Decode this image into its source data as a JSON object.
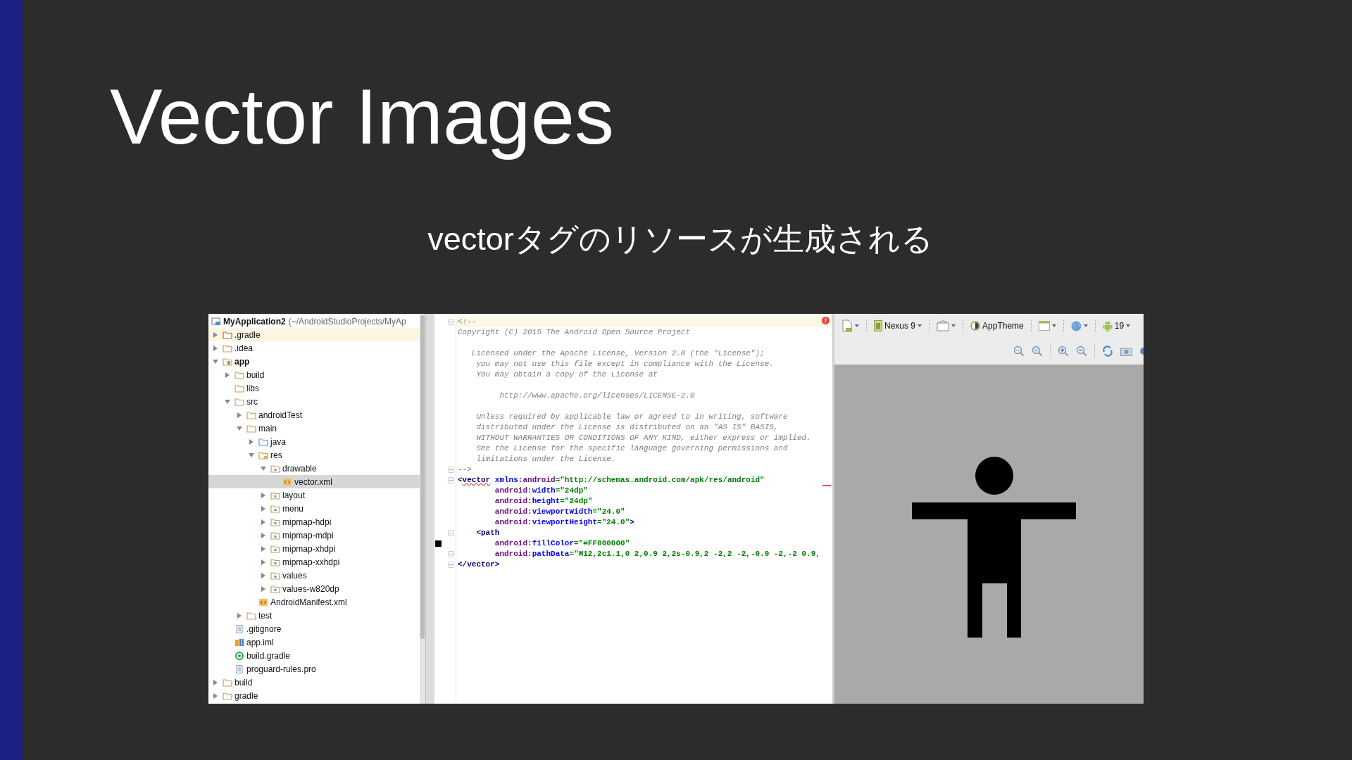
{
  "slide": {
    "title": "Vector Images",
    "subtitle": "vectorタグのリソースが生成される"
  },
  "project_tree": {
    "root": {
      "name": "MyApplication2",
      "path": "(~/AndroidStudioProjects/MyAp"
    },
    "items": [
      {
        "label": ".gradle",
        "kind": "folder-red",
        "expanded": false,
        "selected": false,
        "highlighted": true
      },
      {
        "label": ".idea",
        "kind": "folder",
        "expanded": false,
        "selected": false,
        "highlighted": false
      },
      {
        "label": "app",
        "kind": "module",
        "expanded": true,
        "selected": false,
        "highlighted": false,
        "bold": true,
        "children": [
          {
            "label": "build",
            "kind": "folder",
            "expanded": false,
            "selected": false,
            "highlighted": false
          },
          {
            "label": "libs",
            "kind": "folder",
            "selected": false,
            "highlighted": false
          },
          {
            "label": "src",
            "kind": "folder",
            "expanded": true,
            "selected": false,
            "highlighted": false,
            "children": [
              {
                "label": "androidTest",
                "kind": "folder",
                "expanded": false,
                "selected": false,
                "highlighted": false
              },
              {
                "label": "main",
                "kind": "folder",
                "expanded": true,
                "selected": false,
                "highlighted": false,
                "children": [
                  {
                    "label": "java",
                    "kind": "folder-blue",
                    "expanded": false,
                    "selected": false,
                    "highlighted": false
                  },
                  {
                    "label": "res",
                    "kind": "res",
                    "expanded": true,
                    "selected": false,
                    "highlighted": false,
                    "children": [
                      {
                        "label": "drawable",
                        "kind": "res-folder",
                        "expanded": true,
                        "selected": false,
                        "highlighted": false,
                        "children": [
                          {
                            "label": "vector.xml",
                            "kind": "xml",
                            "selected": true,
                            "highlighted": false
                          }
                        ]
                      },
                      {
                        "label": "layout",
                        "kind": "res-folder",
                        "expanded": false,
                        "selected": false,
                        "highlighted": false
                      },
                      {
                        "label": "menu",
                        "kind": "res-folder",
                        "expanded": false,
                        "selected": false,
                        "highlighted": false
                      },
                      {
                        "label": "mipmap-hdpi",
                        "kind": "res-folder",
                        "expanded": false,
                        "selected": false,
                        "highlighted": false
                      },
                      {
                        "label": "mipmap-mdpi",
                        "kind": "res-folder",
                        "expanded": false,
                        "selected": false,
                        "highlighted": false
                      },
                      {
                        "label": "mipmap-xhdpi",
                        "kind": "res-folder",
                        "expanded": false,
                        "selected": false,
                        "highlighted": false
                      },
                      {
                        "label": "mipmap-xxhdpi",
                        "kind": "res-folder",
                        "expanded": false,
                        "selected": false,
                        "highlighted": false
                      },
                      {
                        "label": "values",
                        "kind": "res-folder",
                        "expanded": false,
                        "selected": false,
                        "highlighted": false
                      },
                      {
                        "label": "values-w820dp",
                        "kind": "res-folder",
                        "expanded": false,
                        "selected": false,
                        "highlighted": false
                      }
                    ]
                  },
                  {
                    "label": "AndroidManifest.xml",
                    "kind": "xml",
                    "selected": false,
                    "highlighted": false
                  }
                ]
              },
              {
                "label": "test",
                "kind": "folder",
                "expanded": false,
                "selected": false,
                "highlighted": false
              }
            ]
          },
          {
            "label": ".gitignore",
            "kind": "text",
            "selected": false,
            "highlighted": false
          },
          {
            "label": "app.iml",
            "kind": "iml",
            "selected": false,
            "highlighted": false
          },
          {
            "label": "build.gradle",
            "kind": "gradle",
            "selected": false,
            "highlighted": false
          },
          {
            "label": "proguard-rules.pro",
            "kind": "text",
            "selected": false,
            "highlighted": false
          }
        ]
      },
      {
        "label": "build",
        "kind": "folder",
        "expanded": false,
        "selected": false,
        "highlighted": false
      },
      {
        "label": "gradle",
        "kind": "folder",
        "expanded": false,
        "selected": false,
        "highlighted": false
      }
    ]
  },
  "editor": {
    "lines": [
      {
        "kind": "fold",
        "current": true,
        "tokens": [
          {
            "kind": "comment",
            "text": "<!--"
          }
        ]
      },
      {
        "kind": "code",
        "current": false,
        "tokens": [
          {
            "kind": "comment",
            "text": "Copyright (C) 2015 The Android Open Source Project"
          }
        ]
      },
      {
        "kind": "blank",
        "current": false
      },
      {
        "kind": "code",
        "current": false,
        "tokens": [
          {
            "kind": "comment",
            "text": "   Licensed under the Apache License, Version 2.0 (the \"License\");"
          }
        ]
      },
      {
        "kind": "code",
        "current": false,
        "tokens": [
          {
            "kind": "comment",
            "text": "    you may not use this file except in compliance with the License."
          }
        ]
      },
      {
        "kind": "code",
        "current": false,
        "tokens": [
          {
            "kind": "comment",
            "text": "    You may obtain a copy of the License at"
          }
        ]
      },
      {
        "kind": "blank",
        "current": false
      },
      {
        "kind": "code",
        "current": false,
        "tokens": [
          {
            "kind": "comment",
            "text": "         http://www.apache.org/licenses/LICENSE-2.0"
          }
        ]
      },
      {
        "kind": "blank",
        "current": false
      },
      {
        "kind": "code",
        "current": false,
        "tokens": [
          {
            "kind": "comment",
            "text": "    Unless required by applicable law or agreed to in writing, software"
          }
        ]
      },
      {
        "kind": "code",
        "current": false,
        "tokens": [
          {
            "kind": "comment",
            "text": "    distributed under the License is distributed on an \"AS IS\" BASIS,"
          }
        ]
      },
      {
        "kind": "code",
        "current": false,
        "tokens": [
          {
            "kind": "comment",
            "text": "    WITHOUT WARRANTIES OR CONDITIONS OF ANY KIND, either express or implied."
          }
        ]
      },
      {
        "kind": "code",
        "current": false,
        "tokens": [
          {
            "kind": "comment",
            "text": "    See the License for the specific language governing permissions and"
          }
        ]
      },
      {
        "kind": "code",
        "current": false,
        "tokens": [
          {
            "kind": "comment",
            "text": "    limitations under the License."
          }
        ]
      },
      {
        "kind": "fold",
        "current": false,
        "tokens": [
          {
            "kind": "comment",
            "text": "-->"
          }
        ]
      },
      {
        "kind": "fold",
        "current": false,
        "tokens": [
          {
            "kind": "tag",
            "text": "<"
          },
          {
            "kind": "tag_error",
            "text": "vector"
          },
          {
            "kind": "attr",
            "text": " xmlns:"
          },
          {
            "kind": "ns",
            "text": "android"
          },
          {
            "kind": "value",
            "text": "=\"http://schemas.android.com/apk/res/android\""
          }
        ]
      },
      {
        "kind": "code",
        "current": false,
        "tokens": [
          {
            "kind": "ns",
            "text": "        android:"
          },
          {
            "kind": "attr",
            "text": "width"
          },
          {
            "kind": "value",
            "text": "=\"24dp\""
          }
        ]
      },
      {
        "kind": "code",
        "current": false,
        "tokens": [
          {
            "kind": "ns",
            "text": "        android:"
          },
          {
            "kind": "attr",
            "text": "height"
          },
          {
            "kind": "value",
            "text": "=\"24dp\""
          }
        ]
      },
      {
        "kind": "code",
        "current": false,
        "tokens": [
          {
            "kind": "ns",
            "text": "        android:"
          },
          {
            "kind": "attr",
            "text": "viewportWidth"
          },
          {
            "kind": "value",
            "text": "=\"24.0\""
          }
        ]
      },
      {
        "kind": "code",
        "current": false,
        "tokens": [
          {
            "kind": "ns",
            "text": "        android:"
          },
          {
            "kind": "attr",
            "text": "viewportHeight"
          },
          {
            "kind": "value",
            "text": "=\"24.0\""
          },
          {
            "kind": "tag",
            "text": ">"
          }
        ]
      },
      {
        "kind": "fold",
        "current": false,
        "tokens": [
          {
            "kind": "tag",
            "text": "    <path"
          }
        ]
      },
      {
        "kind": "swatch",
        "current": false,
        "tokens": [
          {
            "kind": "ns",
            "text": "        android:"
          },
          {
            "kind": "attr",
            "text": "fillColor"
          },
          {
            "kind": "value",
            "text": "=\"#FF000000\""
          }
        ]
      },
      {
        "kind": "fold",
        "current": false,
        "tokens": [
          {
            "kind": "ns",
            "text": "        android:"
          },
          {
            "kind": "attr",
            "text": "pathData"
          },
          {
            "kind": "value",
            "text": "=\"M12,2c1.1,0 2,0.9 2,2s-0.9,2 -2,2 -2,-0.9 -2,-2 0.9,"
          }
        ]
      },
      {
        "kind": "fold",
        "current": false,
        "tokens": [
          {
            "kind": "tag",
            "text": "</vector>"
          }
        ]
      }
    ]
  },
  "preview": {
    "toolbar": {
      "device": "Nexus 9",
      "theme": "AppTheme",
      "api": "19"
    }
  }
}
